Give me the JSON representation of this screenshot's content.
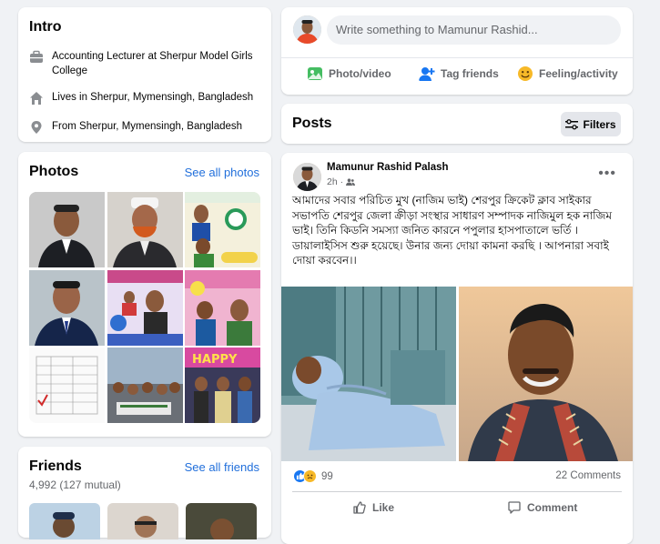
{
  "intro": {
    "title": "Intro",
    "items": [
      {
        "icon": "briefcase-icon",
        "text": "Accounting Lecturer at Sherpur Model Girls College"
      },
      {
        "icon": "home-icon",
        "text": "Lives in Sherpur, Mymensingh, Bangladesh"
      },
      {
        "icon": "location-pin-icon",
        "text": "From Sherpur, Mymensingh, Bangladesh"
      }
    ]
  },
  "photos": {
    "title": "Photos",
    "see_all": "See all photos"
  },
  "friends": {
    "title": "Friends",
    "count": "4,992 (127 mutual)",
    "see_all": "See all friends"
  },
  "composer": {
    "placeholder": "Write something to Mamunur Rashid...",
    "actions": [
      {
        "icon": "photo-video-icon",
        "label": "Photo/video",
        "color": "#45bd62"
      },
      {
        "icon": "tag-friends-icon",
        "label": "Tag friends",
        "color": "#1877f2"
      },
      {
        "icon": "feeling-icon",
        "label": "Feeling/activity",
        "color": "#f7b928"
      }
    ]
  },
  "posts_header": {
    "title": "Posts",
    "filters_label": "Filters"
  },
  "post": {
    "author": "Mamunur Rashid Palash",
    "time": "2h ·",
    "text": "আমাদের সবার পরিচিত মুখ (নাজিম ভাই)  শেরপুর ক্রিকেট ক্লাব সাইকার সভাপতি  শেরপুর জেলা ক্রীড়া সংস্থার সাধারণ সম্পাদক নাজিমুল হক নাজিম ভাই। তিনি কিডনি সমস্যা জনিত কারনে  পপুলার হাসপাতালে ভর্তি ।\n ডায়ালাইসিস শুরু হয়েছে। উনার জন্য দোয়া কামনা করছি । আপনারা সবাই দোয়া করবেন।।",
    "reaction_count": "99",
    "comments": "22 Comments",
    "like_label": "Like",
    "comment_label": "Comment"
  },
  "colors": {
    "link": "#216fdb",
    "background": "#f0f2f5",
    "like_blue": "#1877f2",
    "care_yellow": "#f7b928"
  }
}
